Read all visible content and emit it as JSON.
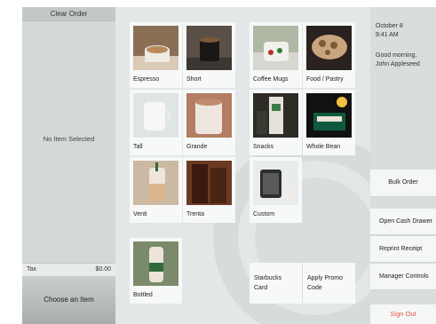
{
  "order": {
    "clear_label": "Clear Order",
    "empty_label": "No Item Selected",
    "tax_label": "Tax",
    "tax_value": "$0.00",
    "choose_label": "Choose an Item"
  },
  "menu": {
    "items": [
      {
        "label": "Espresso"
      },
      {
        "label": "Short"
      },
      {
        "label": "Coffee Mugs"
      },
      {
        "label": "Food / Pastry"
      },
      {
        "label": "Tall"
      },
      {
        "label": "Grande"
      },
      {
        "label": "Snacks"
      },
      {
        "label": "Whole Bean"
      },
      {
        "label": "Venti"
      },
      {
        "label": "Trenta"
      },
      {
        "label": "Custom"
      },
      {
        "label": "Bottled"
      }
    ],
    "starbucks_card": "Starbucks Card",
    "promo_code": "Apply Promo Code"
  },
  "side": {
    "date": "October 8",
    "time": "9:41 AM",
    "greeting": "Good morning,",
    "user": "John Appleseed",
    "buttons": [
      "Bulk Order",
      "Open Cash Drawer",
      "Reprint Receipt",
      "Manager Controls"
    ],
    "signout": "Sign Out"
  },
  "colors": {
    "background": "#e3e7e7",
    "tile": "#f7f9f9",
    "signout": "#e0553d"
  }
}
